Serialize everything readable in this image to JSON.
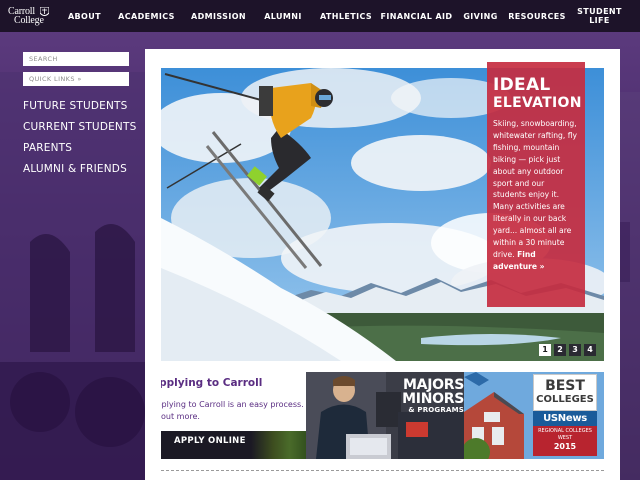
{
  "logo": {
    "line1": "Carroll",
    "line2": "College"
  },
  "topnav": {
    "items": [
      "ABOUT",
      "ACADEMICS",
      "ADMISSION",
      "ALUMNI",
      "ATHLETICS",
      "FINANCIAL AID",
      "GIVING",
      "RESOURCES",
      "STUDENT LIFE"
    ]
  },
  "sidebar": {
    "search_placeholder": "SEARCH",
    "quicklinks_label": "QUICK LINKS »",
    "links": [
      "FUTURE STUDENTS",
      "CURRENT STUDENTS",
      "PARENTS",
      "ALUMNI & FRIENDS"
    ]
  },
  "hero": {
    "title_line1": "IDEAL",
    "title_line2": "ELEVATION",
    "body": "Skiing, snowboarding, whitewater rafting, fly fishing, mountain biking — pick just about any outdoor sport and our students enjoy it. Many activities are literally in our back yard... almost all are within a 30 minute drive.",
    "link_label": "Find adventure »",
    "pager": [
      "1",
      "2",
      "3",
      "4"
    ],
    "pager_active": 0
  },
  "tiles": {
    "apply": {
      "title": "Applying to Carroll",
      "text": "Applying to Carroll is an easy process. Find out more.",
      "button": "APPLY ONLINE"
    },
    "majors": {
      "line1": "MAJORS",
      "line2": "MINORS",
      "line3": "& PROGRAMS"
    },
    "best": {
      "line1": "BEST",
      "line2": "COLLEGES",
      "source": "USNews",
      "ribbon_line1": "REGIONAL COLLEGES",
      "ribbon_line2": "WEST",
      "year": "2015"
    }
  },
  "colors": {
    "purple_bg": "#3a1d57",
    "nav_bg": "#1d1329",
    "hero_card": "#c52c40",
    "accent_purple": "#5a2d82"
  }
}
